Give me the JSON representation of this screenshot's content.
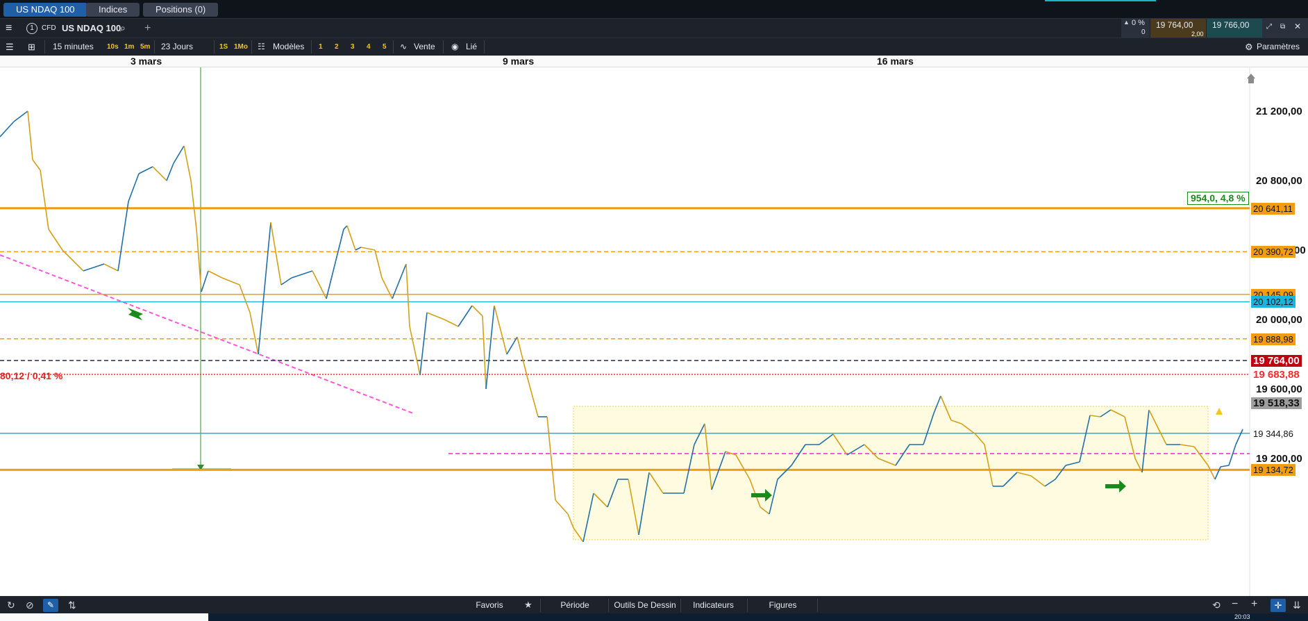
{
  "tabs": [
    {
      "label": "US NDAQ 100",
      "active": true
    },
    {
      "label": "Indices",
      "active": false
    },
    {
      "label": "Positions (0)",
      "active": false
    }
  ],
  "instrument": {
    "badge": "CFD",
    "name": "US NDAQ 100",
    "change_pct": "0 %",
    "change_count": "0",
    "sell_price": "19 764,00",
    "buy_price": "19 766,00",
    "spread": "2,00"
  },
  "toolbar": {
    "interval": "15 minutes",
    "short_intervals": [
      "10s",
      "1m",
      "5m"
    ],
    "range": "23 Jours",
    "long_intervals": [
      "1S",
      "1Mo"
    ],
    "templates_label": "Modèles",
    "numbers": [
      "1",
      "2",
      "3",
      "4",
      "5"
    ],
    "sell_label": "Vente",
    "linked_label": "Lié",
    "settings_label": "Paramètres"
  },
  "dates": [
    "3 mars",
    "9 mars",
    "16 mars"
  ],
  "chart_data": {
    "type": "line",
    "y_axis_ticks": [
      "21 200,00",
      "20 800,00",
      "20 000,00",
      "19 600,00",
      "19 200,00"
    ],
    "y_partial_label": "00",
    "ylim": [
      19060,
      21500
    ],
    "price_levels": [
      {
        "label": "20 641,11",
        "value": 20641.11,
        "color": "#f39c12"
      },
      {
        "label": "20 390,72",
        "value": 20390.72,
        "color": "#f39c12"
      },
      {
        "label": "20 145,09",
        "value": 20145.09,
        "color": "#f39c12"
      },
      {
        "label": "20 102,12",
        "value": 20102.12,
        "color": "#19b5e0"
      },
      {
        "label": "19 888,98",
        "value": 19888.98,
        "color": "#f39c12"
      },
      {
        "label": "19 764,00",
        "value": 19764.0,
        "color": "#c0000f"
      },
      {
        "label": "19 683,88",
        "value": 19683.88,
        "color": "#ff2a2a"
      },
      {
        "label": "19 518,33",
        "value": 19518.33,
        "color": "#9e9e9e"
      },
      {
        "label": "19 344,86",
        "value": 19344.86,
        "color": "#19b5e0"
      },
      {
        "label": "19 134,72",
        "value": 19134.72,
        "color": "#f39c12"
      }
    ],
    "measure_label": "954,0, 4,8 %",
    "change_label": "80,12 / 0,41 %"
  },
  "bottom": {
    "favorites": "Favoris",
    "period": "Période",
    "drawing_tools": "Outils De Dessin",
    "indicators": "Indicateurs",
    "figures": "Figures"
  },
  "taskbar": {
    "clock": "20:03"
  },
  "colors": {
    "up": "#1f6fa8",
    "down": "#d4a017",
    "accent": "#1f5fa8"
  }
}
